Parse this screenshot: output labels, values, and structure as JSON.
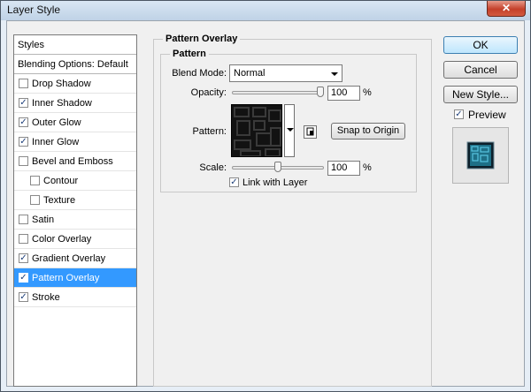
{
  "window": {
    "title": "Layer Style",
    "close_glyph": "✕"
  },
  "styles_list": {
    "header": "Styles",
    "blending_label": "Blending Options: Default",
    "items": [
      {
        "label": "Drop Shadow",
        "checked": false,
        "indent": false,
        "selected": false
      },
      {
        "label": "Inner Shadow",
        "checked": true,
        "indent": false,
        "selected": false
      },
      {
        "label": "Outer Glow",
        "checked": true,
        "indent": false,
        "selected": false
      },
      {
        "label": "Inner Glow",
        "checked": true,
        "indent": false,
        "selected": false
      },
      {
        "label": "Bevel and Emboss",
        "checked": false,
        "indent": false,
        "selected": false
      },
      {
        "label": "Contour",
        "checked": false,
        "indent": true,
        "selected": false
      },
      {
        "label": "Texture",
        "checked": false,
        "indent": true,
        "selected": false
      },
      {
        "label": "Satin",
        "checked": false,
        "indent": false,
        "selected": false
      },
      {
        "label": "Color Overlay",
        "checked": false,
        "indent": false,
        "selected": false
      },
      {
        "label": "Gradient Overlay",
        "checked": true,
        "indent": false,
        "selected": false
      },
      {
        "label": "Pattern Overlay",
        "checked": true,
        "indent": false,
        "selected": true
      },
      {
        "label": "Stroke",
        "checked": true,
        "indent": false,
        "selected": false
      }
    ]
  },
  "pattern_overlay": {
    "title": "Pattern Overlay",
    "group_title": "Pattern",
    "blend_mode_label": "Blend Mode:",
    "blend_mode_value": "Normal",
    "opacity_label": "Opacity:",
    "opacity_value": "100",
    "opacity_level": 1.0,
    "opacity_unit": "%",
    "pattern_label": "Pattern:",
    "snap_button": "Snap to Origin",
    "scale_label": "Scale:",
    "scale_value": "100",
    "scale_level": 0.5,
    "scale_unit": "%",
    "link_label": "Link with Layer",
    "link_checked": true
  },
  "buttons": {
    "ok": "OK",
    "cancel": "Cancel",
    "new_style": "New Style..."
  },
  "preview": {
    "label": "Preview",
    "checked": true
  },
  "colors": {
    "selection": "#3399ff",
    "preview_teal": "#1e6f86"
  }
}
